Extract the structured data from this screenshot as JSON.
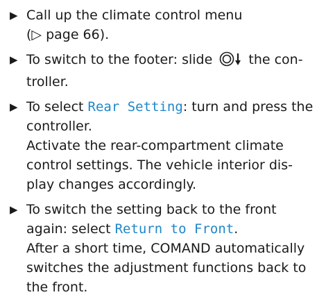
{
  "steps": [
    {
      "text": "Call up the climate control menu",
      "ref": "(▷ page 66)."
    },
    {
      "pre": "To switch to the footer: slide",
      "icon": "controller-slide-down-icon",
      "post": "the con- troller."
    },
    {
      "pre": "To select",
      "keyword": "Rear Setting",
      "post": ": turn and press the controller.",
      "note": "Activate the rear-compartment climate control settings. The vehicle interior dis- play changes accordingly."
    },
    {
      "pre": "To switch the setting back to the front again: select",
      "keyword": "Return to Front",
      "post": ".",
      "note": "After a short time, COMAND automatically switches the adjustment functions back to the front."
    }
  ],
  "bullet": "▶",
  "keyword_color": "#1f86c8"
}
